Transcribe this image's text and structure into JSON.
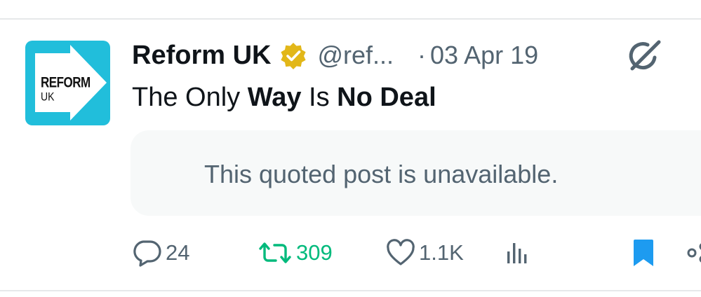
{
  "post": {
    "avatar": {
      "line1": "REFORM",
      "line2": "UK",
      "bg_color": "#21bedb"
    },
    "author": {
      "display_name": "Reform UK",
      "handle": "@ref...",
      "verified_badge": "gold-verified-icon"
    },
    "separator": "·",
    "date": "03 Apr 19",
    "text": {
      "part1": "The Only ",
      "part2_bold": "Way",
      "part3": " Is ",
      "part4_bold": "No Deal"
    },
    "quoted_post": {
      "message": "This quoted post is unavailable."
    },
    "actions": {
      "reply_count": "24",
      "retweet_count": "309",
      "like_count": "1.1K",
      "retweet_color": "#00ba7c",
      "bookmark_color": "#1d9bf0",
      "muted_color": "#536471"
    }
  }
}
